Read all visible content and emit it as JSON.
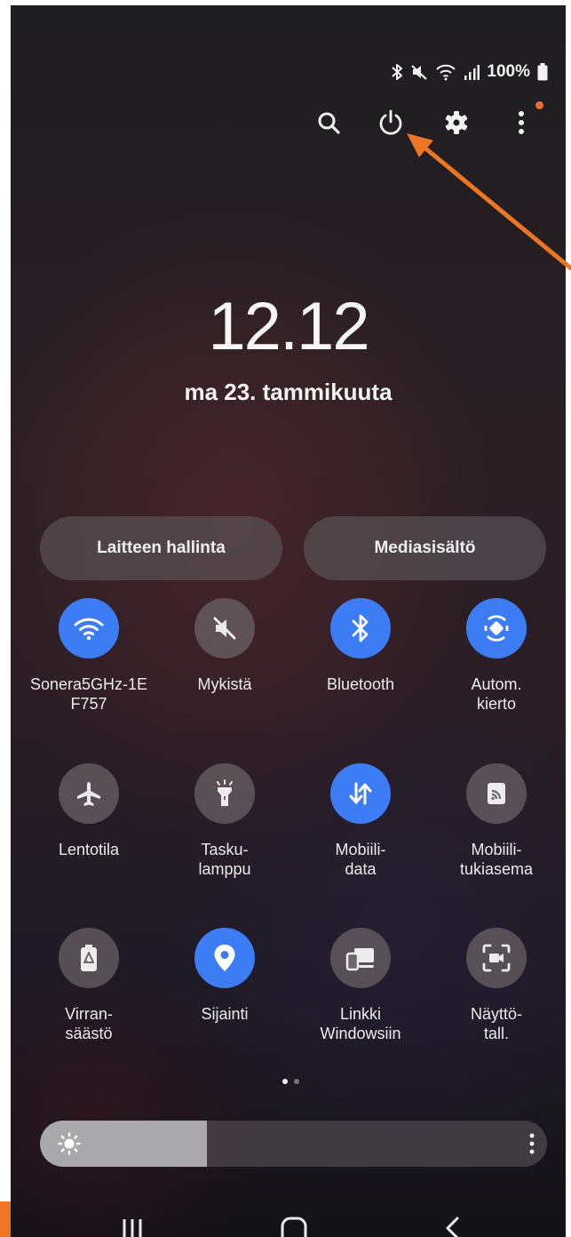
{
  "status_bar": {
    "battery": "100%"
  },
  "top_icons": [
    "search-icon",
    "power-icon",
    "settings-icon",
    "more-vert-icon"
  ],
  "clock": {
    "time": "12.12",
    "date": "ma 23. tammikuuta"
  },
  "pills": {
    "device_control": "Laitteen hallinta",
    "media": "Mediasisältö"
  },
  "tiles": [
    {
      "line1": "Sonera5GHz-1E",
      "line2": "F757",
      "icon": "wifi-icon",
      "active": true
    },
    {
      "line1": "Mykistä",
      "line2": "",
      "icon": "mute-icon",
      "active": false
    },
    {
      "line1": "Bluetooth",
      "line2": "",
      "icon": "bluetooth-icon",
      "active": true
    },
    {
      "line1": "Autom.",
      "line2": "kierto",
      "icon": "auto-rotate-icon",
      "active": true
    },
    {
      "line1": "Lentotila",
      "line2": "",
      "icon": "airplane-icon",
      "active": false
    },
    {
      "line1": "Tasku-",
      "line2": "lamppu",
      "icon": "flashlight-icon",
      "active": false
    },
    {
      "line1": "Mobiili-",
      "line2": "data",
      "icon": "mobile-data-icon",
      "active": true
    },
    {
      "line1": "Mobiili-",
      "line2": "tukiasema",
      "icon": "hotspot-icon",
      "active": false
    },
    {
      "line1": "Virran-",
      "line2": "säästö",
      "icon": "power-saving-icon",
      "active": false
    },
    {
      "line1": "Sijainti",
      "line2": "",
      "icon": "location-icon",
      "active": true
    },
    {
      "line1": "Linkki",
      "line2": "Windowsiin",
      "icon": "link-to-windows-icon",
      "active": false
    },
    {
      "line1": "Näyttö-",
      "line2": "tall.",
      "icon": "screen-recorder-icon",
      "active": false
    }
  ],
  "page_indicator": {
    "count": 2,
    "current": 1
  },
  "brightness": {
    "level": 0.33
  },
  "nav_bar": [
    "recents-icon",
    "home-icon",
    "back-icon"
  ],
  "colors": {
    "accent_blue": "#3c7cf5",
    "annotation_orange": "#ee7623"
  }
}
